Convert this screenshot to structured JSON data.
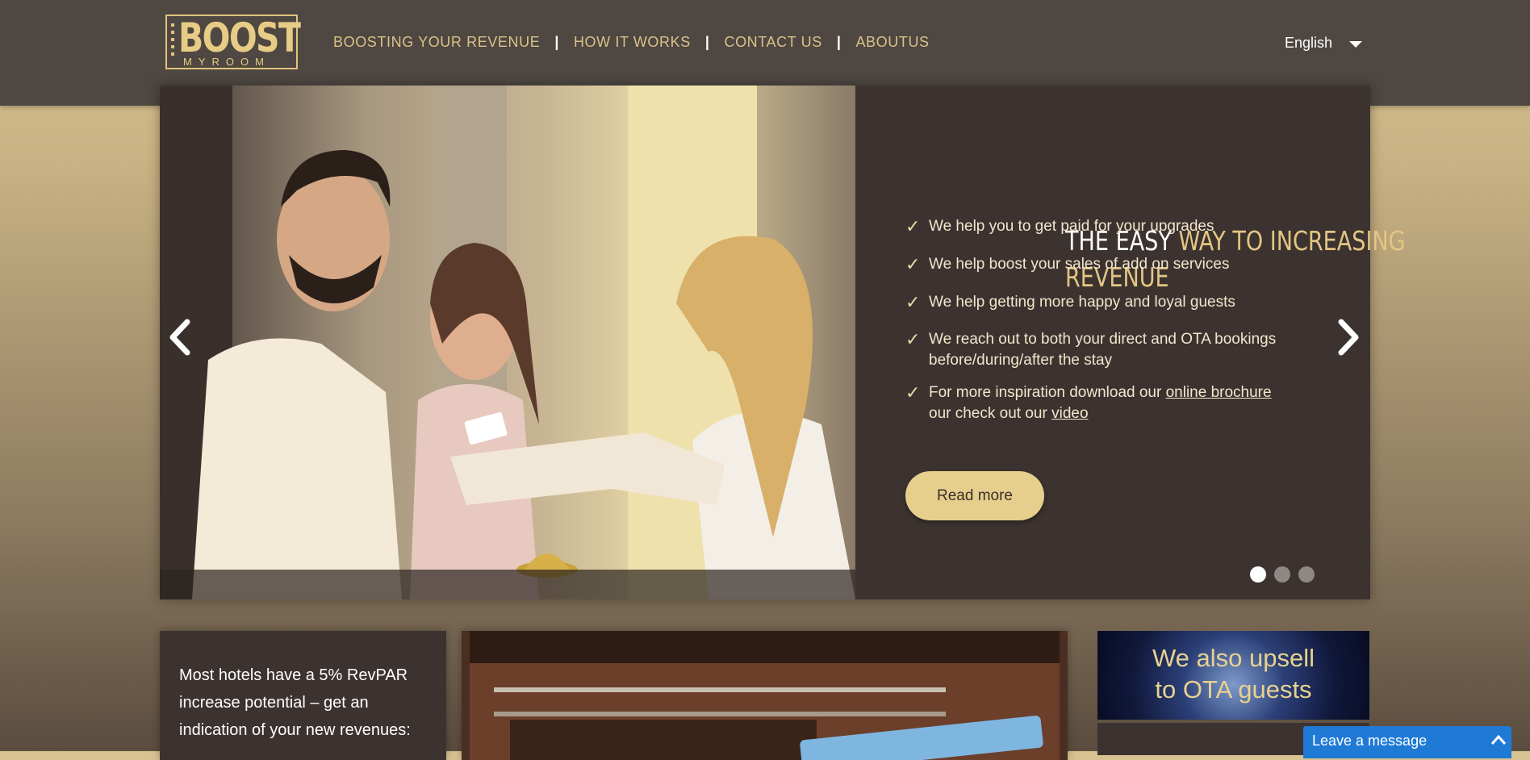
{
  "logo": {
    "big": "BOOST",
    "small": "MYROOM"
  },
  "nav": {
    "items": [
      "BOOSTING YOUR REVENUE",
      "HOW IT WORKS",
      "CONTACT US",
      "ABOUTUS"
    ],
    "separator": "|"
  },
  "language": {
    "selected": "English"
  },
  "hero": {
    "title_white": "THE EASY",
    "title_accent_1": "WAY TO INCREASING",
    "title_accent_2": "REVENUE",
    "bullets": [
      "We help you to get paid for your upgrades",
      "We help boost your sales of add on services",
      "We help getting more happy and loyal guests",
      "We reach out to both your direct and OTA bookings",
      "before/during/after the stay"
    ],
    "bullet5": {
      "pre": "For more inspiration download our",
      "link1": "online brochure",
      "mid": "our check out our",
      "link2": "video"
    },
    "check": "✓",
    "read_more": "Read more",
    "slides_total": 3,
    "slide_active": 1
  },
  "cards": {
    "left_text_1": "Most hotels have a 5% RevPAR",
    "left_text_2": "increase potential – get an",
    "left_text_3": "indication of your new revenues:",
    "right_line1": "We also upsell",
    "right_line2": "to OTA guests"
  },
  "chat": {
    "label": "Leave a message"
  },
  "colors": {
    "accent": "#e3c684",
    "panel": "#3c3330",
    "chat": "#1f7ad6"
  }
}
